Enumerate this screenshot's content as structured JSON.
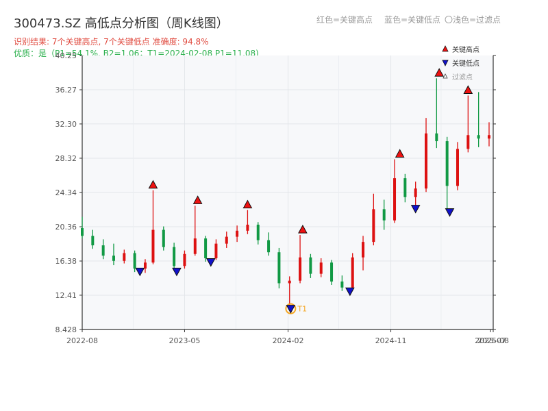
{
  "header": {
    "title": "300473.SZ 高低点分析图（周K线图）",
    "legend_red": "红色=关键高点",
    "legend_blue": "蓝色=关键低点",
    "legend_light": "〇浅色=过滤点",
    "result_line": "识别结果: 7个关键高点, 7个关键低点  准确度: 94.8%",
    "quality_line": "优质：是（P1=54.1%, B2=1.06；T1=2024-02-08 P1=11.08)"
  },
  "colors": {
    "up": "#dd1111",
    "down": "#119944",
    "high_marker": "#ee1111",
    "low_marker": "#1111cc",
    "t1": "#f5a623",
    "result_text": "#e04a3f",
    "quality_text": "#2bb04d"
  },
  "chart_data": {
    "type": "candlestick",
    "title": "300473.SZ 高低点分析图（周K线图）",
    "ylim": [
      8.428,
      40.25
    ],
    "y_ticks": [
      "8.428",
      "12.41",
      "16.38",
      "20.36",
      "24.34",
      "28.32",
      "32.30",
      "36.27",
      "40.25"
    ],
    "x_ticks": [
      "2022-08",
      "2023-05",
      "2024-02",
      "2024-11",
      "2025-07",
      "2025-08"
    ],
    "x_range": [
      "2022-08-01",
      "2025-08-01"
    ],
    "legend": {
      "position": "top-right",
      "entries": [
        "关键高点",
        "关键低点",
        "过滤点"
      ]
    },
    "grid": true,
    "key_highs": [
      {
        "date": "2023-02-06",
        "value": 24.6
      },
      {
        "date": "2023-06-05",
        "value": 22.8
      },
      {
        "date": "2023-10-16",
        "value": 22.3
      },
      {
        "date": "2024-03-11",
        "value": 19.4
      },
      {
        "date": "2024-11-25",
        "value": 28.2
      },
      {
        "date": "2025-03-10",
        "value": 37.6
      },
      {
        "date": "2025-05-26",
        "value": 35.6
      }
    ],
    "key_lows": [
      {
        "date": "2023-01-02",
        "value": 15.4
      },
      {
        "date": "2023-04-10",
        "value": 15.4
      },
      {
        "date": "2023-07-10",
        "value": 16.5
      },
      {
        "date": "2024-02-08",
        "value": 11.08,
        "label": "T1"
      },
      {
        "date": "2024-07-15",
        "value": 13.1
      },
      {
        "date": "2025-01-06",
        "value": 22.7
      },
      {
        "date": "2025-04-07",
        "value": 22.3
      }
    ],
    "candles": [
      {
        "date": "2022-08-01",
        "open": 20.2,
        "high": 21.5,
        "low": 19.0,
        "close": 19.3
      },
      {
        "date": "2022-08-29",
        "open": 19.3,
        "high": 20.0,
        "low": 17.8,
        "close": 18.2
      },
      {
        "date": "2022-09-26",
        "open": 18.2,
        "high": 18.9,
        "low": 16.6,
        "close": 17.0
      },
      {
        "date": "2022-10-24",
        "open": 17.0,
        "high": 18.4,
        "low": 15.9,
        "close": 16.4
      },
      {
        "date": "2022-11-21",
        "open": 16.4,
        "high": 17.7,
        "low": 16.1,
        "close": 17.3
      },
      {
        "date": "2022-12-19",
        "open": 17.3,
        "high": 17.6,
        "low": 15.1,
        "close": 15.5
      },
      {
        "date": "2023-01-16",
        "open": 15.5,
        "high": 16.6,
        "low": 15.0,
        "close": 16.2
      },
      {
        "date": "2023-02-06",
        "open": 16.2,
        "high": 24.6,
        "low": 16.0,
        "close": 20.0
      },
      {
        "date": "2023-03-06",
        "open": 20.0,
        "high": 20.4,
        "low": 17.6,
        "close": 18.0
      },
      {
        "date": "2023-04-03",
        "open": 18.0,
        "high": 18.5,
        "low": 15.2,
        "close": 15.8
      },
      {
        "date": "2023-05-01",
        "open": 15.8,
        "high": 17.6,
        "low": 15.5,
        "close": 17.2
      },
      {
        "date": "2023-05-29",
        "open": 17.2,
        "high": 22.8,
        "low": 17.0,
        "close": 19.0
      },
      {
        "date": "2023-06-26",
        "open": 19.0,
        "high": 19.3,
        "low": 16.3,
        "close": 16.7
      },
      {
        "date": "2023-07-24",
        "open": 16.7,
        "high": 18.9,
        "low": 16.5,
        "close": 18.4
      },
      {
        "date": "2023-08-21",
        "open": 18.4,
        "high": 19.8,
        "low": 17.9,
        "close": 19.2
      },
      {
        "date": "2023-09-18",
        "open": 19.2,
        "high": 20.5,
        "low": 18.6,
        "close": 19.9
      },
      {
        "date": "2023-10-16",
        "open": 19.9,
        "high": 22.3,
        "low": 19.5,
        "close": 20.6
      },
      {
        "date": "2023-11-13",
        "open": 20.6,
        "high": 20.9,
        "low": 18.3,
        "close": 18.8
      },
      {
        "date": "2023-12-11",
        "open": 18.8,
        "high": 19.7,
        "low": 17.0,
        "close": 17.4
      },
      {
        "date": "2024-01-08",
        "open": 17.4,
        "high": 17.9,
        "low": 13.2,
        "close": 13.8
      },
      {
        "date": "2024-02-05",
        "open": 13.8,
        "high": 14.6,
        "low": 11.08,
        "close": 14.1
      },
      {
        "date": "2024-03-04",
        "open": 14.1,
        "high": 19.4,
        "low": 13.8,
        "close": 16.8
      },
      {
        "date": "2024-04-01",
        "open": 16.8,
        "high": 17.2,
        "low": 14.4,
        "close": 14.9
      },
      {
        "date": "2024-04-29",
        "open": 14.9,
        "high": 16.7,
        "low": 14.5,
        "close": 16.2
      },
      {
        "date": "2024-05-27",
        "open": 16.2,
        "high": 16.5,
        "low": 13.6,
        "close": 14.0
      },
      {
        "date": "2024-06-24",
        "open": 14.0,
        "high": 14.7,
        "low": 12.9,
        "close": 13.3
      },
      {
        "date": "2024-07-22",
        "open": 13.3,
        "high": 17.3,
        "low": 13.1,
        "close": 16.8
      },
      {
        "date": "2024-08-19",
        "open": 16.8,
        "high": 19.3,
        "low": 15.3,
        "close": 18.6
      },
      {
        "date": "2024-09-16",
        "open": 18.6,
        "high": 24.2,
        "low": 18.2,
        "close": 22.4
      },
      {
        "date": "2024-10-14",
        "open": 22.4,
        "high": 23.5,
        "low": 20.0,
        "close": 21.1
      },
      {
        "date": "2024-11-11",
        "open": 21.1,
        "high": 28.2,
        "low": 20.8,
        "close": 26.0
      },
      {
        "date": "2024-12-09",
        "open": 26.0,
        "high": 26.5,
        "low": 23.2,
        "close": 23.8
      },
      {
        "date": "2025-01-06",
        "open": 23.8,
        "high": 25.6,
        "low": 22.7,
        "close": 24.8
      },
      {
        "date": "2025-02-03",
        "open": 24.8,
        "high": 33.0,
        "low": 24.4,
        "close": 31.2
      },
      {
        "date": "2025-03-03",
        "open": 31.2,
        "high": 37.6,
        "low": 29.5,
        "close": 30.3
      },
      {
        "date": "2025-03-31",
        "open": 30.3,
        "high": 30.8,
        "low": 22.3,
        "close": 25.1
      },
      {
        "date": "2025-04-28",
        "open": 25.1,
        "high": 30.2,
        "low": 24.6,
        "close": 29.4
      },
      {
        "date": "2025-05-26",
        "open": 29.4,
        "high": 35.6,
        "low": 29.0,
        "close": 31.0
      },
      {
        "date": "2025-06-23",
        "open": 31.0,
        "high": 36.0,
        "low": 29.6,
        "close": 30.6
      },
      {
        "date": "2025-07-21",
        "open": 30.6,
        "high": 32.5,
        "low": 29.7,
        "close": 31.0
      }
    ]
  }
}
